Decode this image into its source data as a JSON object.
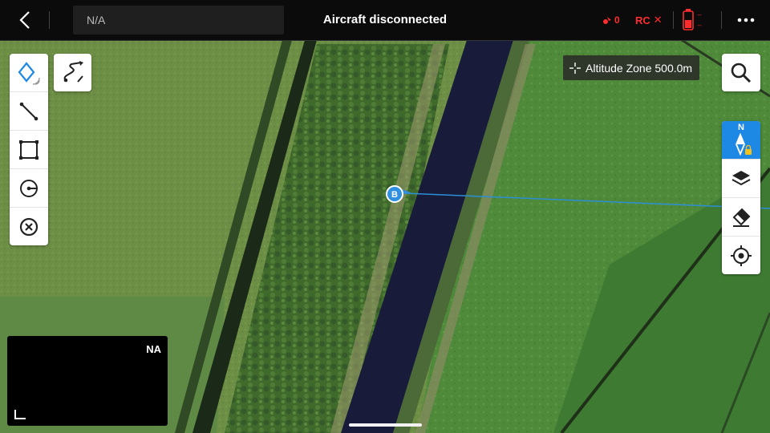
{
  "topbar": {
    "project_name": "N/A",
    "title": "Aircraft disconnected",
    "signal_count": "0",
    "rc_label": "RC",
    "rc_status_mark": "✕",
    "battery_top": "--",
    "battery_bottom": "--"
  },
  "altitude_zone": {
    "label": "Altitude Zone 500.0m"
  },
  "compass": {
    "north_label": "N"
  },
  "mini_view": {
    "label": "NA"
  },
  "colors": {
    "alert_red": "#ff2d2d",
    "compass_blue": "#1e88e5",
    "active_tool_blue": "#1e88e5",
    "flight_line_blue": "#2b8fd6",
    "marker_blue": "#2f8fe0"
  },
  "icons": {
    "back": "chevron-left-icon",
    "signal": "aircraft-signal-icon",
    "battery": "battery-icon",
    "more": "more-dots-icon",
    "waypoint": "waypoint-diamond-icon",
    "route": "route-path-icon",
    "line": "line-segment-icon",
    "area": "area-square-icon",
    "oblique": "circle-dot-icon",
    "delete": "delete-circle-icon",
    "search": "search-icon",
    "compass": "compass-lock-icon",
    "layers": "layers-icon",
    "eraser": "eraser-icon",
    "locate": "locate-target-icon",
    "marker": "aircraft-marker-icon"
  }
}
